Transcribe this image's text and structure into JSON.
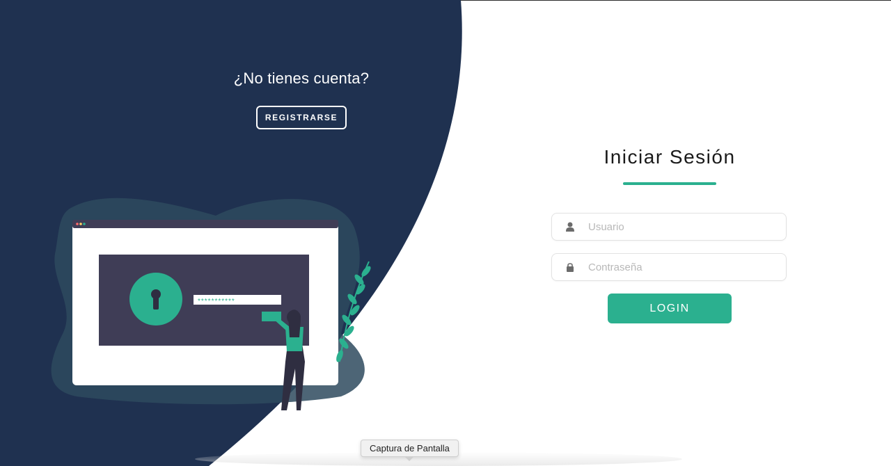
{
  "colors": {
    "dark_panel": "#1f3150",
    "accent": "#2bb08f",
    "white": "#ffffff"
  },
  "signup": {
    "title": "¿No tienes cuenta?",
    "button_label": "REGISTRARSE"
  },
  "illustration": {
    "password_mask": "***********"
  },
  "login": {
    "title": "Iniciar Sesión",
    "username_placeholder": "Usuario",
    "password_placeholder": "Contraseña",
    "username_icon": "user-icon",
    "password_icon": "lock-icon",
    "button_label": "LOGIN"
  },
  "tooltip": {
    "text": "Captura de Pantalla"
  }
}
